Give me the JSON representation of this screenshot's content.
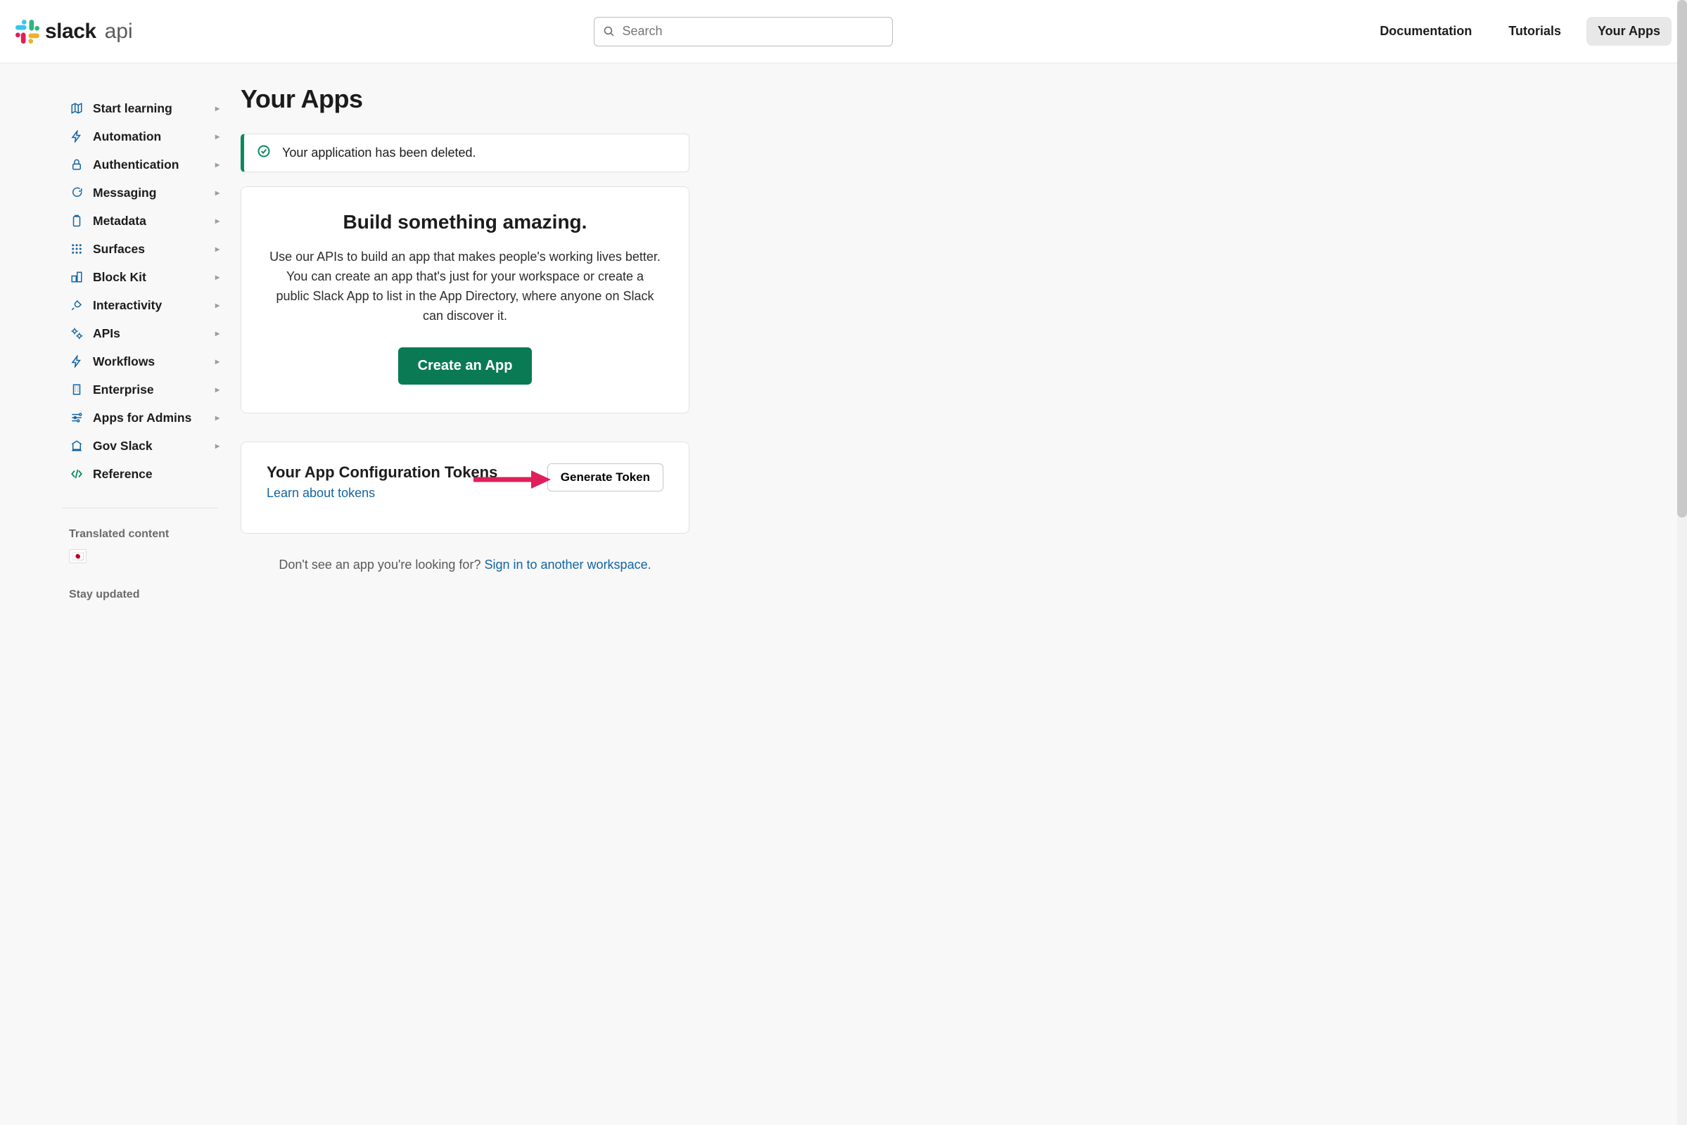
{
  "header": {
    "brand_main": "slack",
    "brand_sub": "api",
    "search_placeholder": "Search",
    "nav": {
      "documentation": "Documentation",
      "tutorials": "Tutorials",
      "your_apps": "Your Apps"
    }
  },
  "sidebar": {
    "items": [
      {
        "label": "Start learning",
        "icon": "map-icon"
      },
      {
        "label": "Automation",
        "icon": "bolt-icon"
      },
      {
        "label": "Authentication",
        "icon": "lock-icon"
      },
      {
        "label": "Messaging",
        "icon": "chat-icon"
      },
      {
        "label": "Metadata",
        "icon": "clipboard-icon"
      },
      {
        "label": "Surfaces",
        "icon": "grid-icon"
      },
      {
        "label": "Block Kit",
        "icon": "blocks-icon"
      },
      {
        "label": "Interactivity",
        "icon": "plug-icon"
      },
      {
        "label": "APIs",
        "icon": "gears-icon"
      },
      {
        "label": "Workflows",
        "icon": "bolt-icon"
      },
      {
        "label": "Enterprise",
        "icon": "building-icon"
      },
      {
        "label": "Apps for Admins",
        "icon": "sliders-icon"
      },
      {
        "label": "Gov Slack",
        "icon": "gov-icon"
      },
      {
        "label": "Reference",
        "icon": "code-icon"
      }
    ],
    "translated_heading": "Translated content",
    "translated_flag": "🇯🇵",
    "stay_updated_heading": "Stay updated"
  },
  "main": {
    "title": "Your Apps",
    "alert_text": "Your application has been deleted.",
    "hero": {
      "heading": "Build something amazing.",
      "body": "Use our APIs to build an app that makes people's working lives better. You can create an app that's just for your workspace or create a public Slack App to list in the App Directory, where anyone on Slack can discover it.",
      "cta": "Create an App"
    },
    "tokens": {
      "heading": "Your App Configuration Tokens",
      "learn_link": "Learn about tokens",
      "generate_button": "Generate Token"
    },
    "footer": {
      "text_before": "Don't see an app you're looking for? ",
      "link": "Sign in to another workspace",
      "text_after": "."
    }
  },
  "colors": {
    "accent_green": "#0a7a54",
    "link_blue": "#1264a3",
    "annotation_red": "#e01e5a"
  }
}
